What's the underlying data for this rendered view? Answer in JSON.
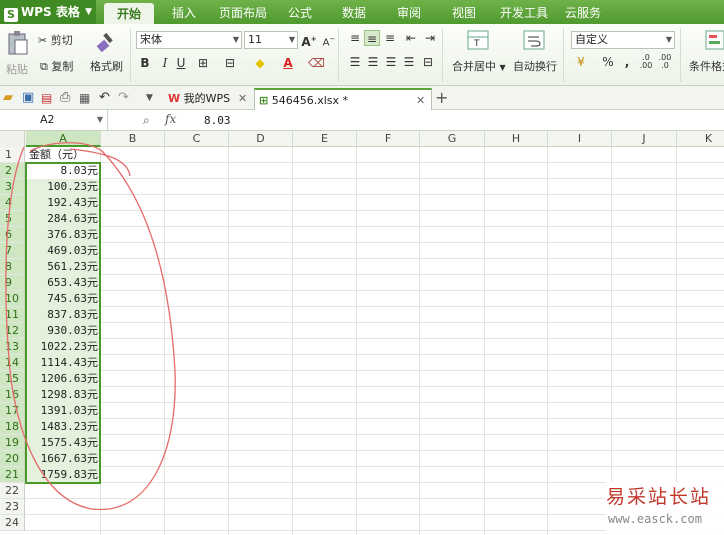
{
  "app": {
    "name": "WPS 表格"
  },
  "ribbon_tabs": [
    "开始",
    "插入",
    "页面布局",
    "公式",
    "数据",
    "审阅",
    "视图",
    "开发工具",
    "云服务"
  ],
  "ribbon": {
    "paste": "粘贴",
    "cut": "剪切",
    "copy": "复制",
    "format_painter": "格式刷",
    "font_name": "宋体",
    "font_size": "11",
    "merge_center": "合并居中",
    "wrap_text": "自动换行",
    "number_format": "自定义",
    "conditional_format": "条件格式",
    "bold": "B",
    "italic": "I",
    "underline": "U",
    "percent": "%",
    "comma": ","
  },
  "doc_tabs": [
    {
      "label": "我的WPS"
    },
    {
      "label": "546456.xlsx *"
    }
  ],
  "formula_bar": {
    "name_box": "A2",
    "fx": "fx",
    "value": "8.03"
  },
  "columns": [
    "A",
    "B",
    "C",
    "D",
    "E",
    "F",
    "G",
    "H",
    "I",
    "J",
    "K"
  ],
  "rows": [
    "1",
    "2",
    "3",
    "4",
    "5",
    "6",
    "7",
    "8",
    "9",
    "10",
    "11",
    "12",
    "13",
    "14",
    "15",
    "16",
    "17",
    "18",
    "19",
    "20",
    "21",
    "22",
    "23",
    "24"
  ],
  "sheet": {
    "header": "金额（元）",
    "values": [
      "8.03元",
      "100.23元",
      "192.43元",
      "284.63元",
      "376.83元",
      "469.03元",
      "561.23元",
      "653.43元",
      "745.63元",
      "837.83元",
      "930.03元",
      "1022.23元",
      "1114.43元",
      "1206.63元",
      "1298.83元",
      "1391.03元",
      "1483.23元",
      "1575.43元",
      "1667.63元",
      "1759.83元"
    ]
  },
  "watermark": {
    "title": "易采站长站",
    "url": "www.easck.com"
  },
  "colors": {
    "brand": "#4f9a2e",
    "annotation": "#e05050",
    "selection": "#e4f1dc"
  }
}
